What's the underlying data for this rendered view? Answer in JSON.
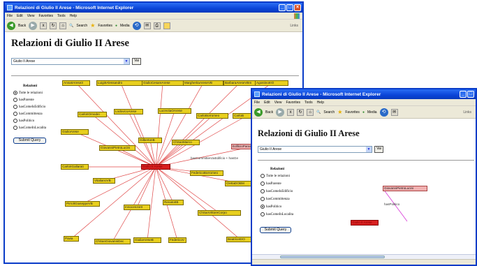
{
  "window1": {
    "title": "Relazioni di Giulio II Arese - Microsoft Internet Explorer",
    "menu": [
      "File",
      "Edit",
      "View",
      "Favorites",
      "Tools",
      "Help"
    ],
    "toolbar": {
      "back": "Back",
      "search": "Search",
      "favorites": "Favorites",
      "media": "Media",
      "links": "Links"
    },
    "heading": "Relazioni di Giulio II Arese",
    "select_value": "Giulio II Arese",
    "vai": "Vai",
    "relations_label": "Relazioni",
    "radios": [
      "Tutte le relazioni",
      "hasParente",
      "hasComeIsEdificio",
      "hasCommittenza",
      "hasPolitico",
      "hasComeInLocalita"
    ],
    "selected_radio": 0,
    "submit": "Submit Query",
    "center_node": "Giulio II Arese",
    "edge_label": "hasCommittenza",
    "edge_label2": "basCommittenzaEdificio + hasGe",
    "nodes": [
      "AnnaIIArese3",
      "LuigiIIAlessandro",
      "GiulioCesareArese",
      "MargheritaAreseVB",
      "BarbaraAreseVBm",
      "AgostinoIIIO",
      "CarloIIOmodei",
      "LodovicoArese",
      "LucreziaOArese",
      "CarloBorromeo",
      "CarloB",
      "GiulioArese",
      "GiovanniPietroLucini",
      "GilbertoIIB",
      "ChSanMarco",
      "EdificioParazaleGuido",
      "CarloIIGallarati",
      "FedericoBorromeo",
      "ClettaDOBM",
      "VitalianoVB",
      "PirrolIGiuseppeVB",
      "InnocenzoIII",
      "RenatoIIB",
      "ChSanVittoreCorpo",
      "ChSanGiovanniDec",
      "Pavia",
      "GiuliaAreseB",
      "FedericoV",
      "BeatriceEIO"
    ]
  },
  "window2": {
    "title": "Relazioni di Giulio II Arese - Microsoft Internet Explorer",
    "menu": [
      "File",
      "Edit",
      "View",
      "Favorites",
      "Tools",
      "Help"
    ],
    "toolbar": {
      "back": "Back",
      "search": "Search",
      "favorites": "Favorites",
      "media": "Media",
      "links": "Links"
    },
    "heading": "Relazioni di Giulio II Arese",
    "select_value": "Giulio II Arese",
    "vai": "Vai",
    "relations_label": "Relazioni",
    "radios": [
      "Tutte le relazioni",
      "hasParente",
      "hasComeIsEdificio",
      "hasCommittenza",
      "hasPolitico",
      "hasComeInLocalita"
    ],
    "selected_radio": 4,
    "submit": "Submit Query",
    "node_top": "GiovanniPietroLucini",
    "node_bottom": "Giulio II Arese",
    "edge_label": "hasPolitico"
  },
  "colors": {
    "titlebar": "#0a44d8",
    "node": "#e8cf1e",
    "center": "#d82020",
    "edge": "#e04848"
  }
}
